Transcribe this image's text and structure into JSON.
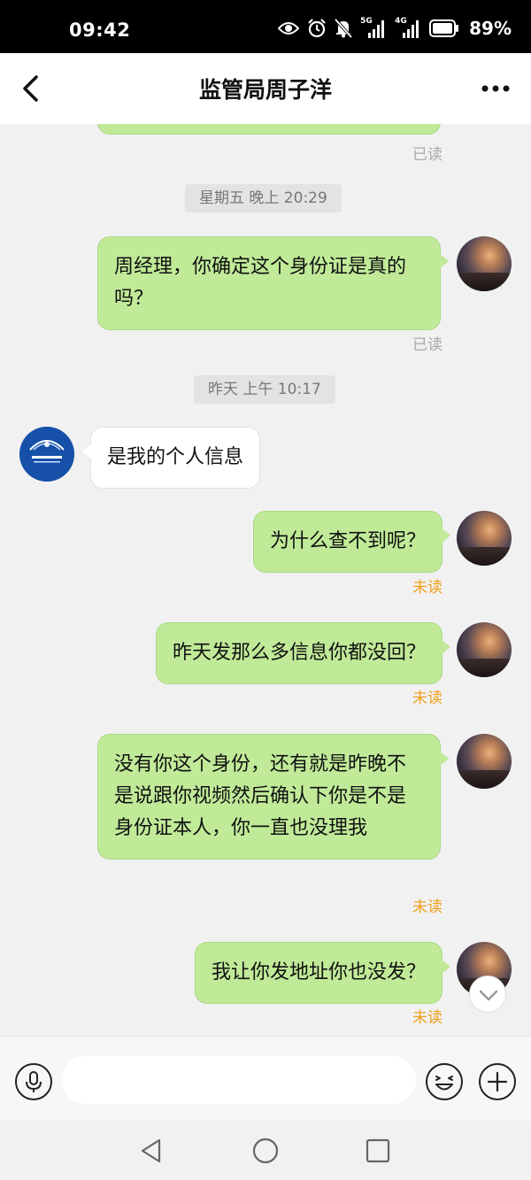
{
  "status_bar": {
    "time": "09:42",
    "net_5g": "5G",
    "net_4g": "4G",
    "battery_percent": "89%"
  },
  "header": {
    "title": "监管局周子洋"
  },
  "messages": [
    {
      "direction": "out",
      "text": "",
      "status": "已读",
      "status_type": "read"
    },
    {
      "type": "timestamp",
      "text": "星期五 晚上 20:29"
    },
    {
      "direction": "out",
      "text": "周经理，你确定这个身份证是真的吗？",
      "status": "已读",
      "status_type": "read"
    },
    {
      "type": "timestamp",
      "text": "昨天 上午 10:17"
    },
    {
      "direction": "in",
      "text": "是我的个人信息"
    },
    {
      "direction": "out",
      "text": "为什么查不到呢？",
      "status": "未读",
      "status_type": "unread"
    },
    {
      "direction": "out",
      "text": "昨天发那么多信息你都没回？",
      "status": "未读",
      "status_type": "unread"
    },
    {
      "direction": "out",
      "text": "没有你这个身份，还有就是昨晚不是说跟你视频然后确认下你是不是身份证本人，你一直也没理我",
      "status": "未读",
      "status_type": "unread"
    },
    {
      "direction": "out",
      "text": "我让你发地址你也没发？",
      "status": "未读",
      "status_type": "unread"
    }
  ],
  "input_bar": {
    "placeholder": ""
  },
  "icons": {
    "back": "chevron-left-icon",
    "more": "more-dots-icon",
    "voice": "microphone-icon",
    "emoji": "emoji-icon",
    "plus": "plus-icon",
    "scroll_down": "chevron-down-icon",
    "nav_back": "triangle-back-icon",
    "nav_home": "circle-home-icon",
    "nav_recents": "square-recents-icon"
  },
  "colors": {
    "outgoing_bubble": "#c0ea98",
    "incoming_bubble": "#ffffff",
    "read_status": "#aaaaaa",
    "unread_status": "#f0a01e",
    "background": "#f1f1f1"
  }
}
